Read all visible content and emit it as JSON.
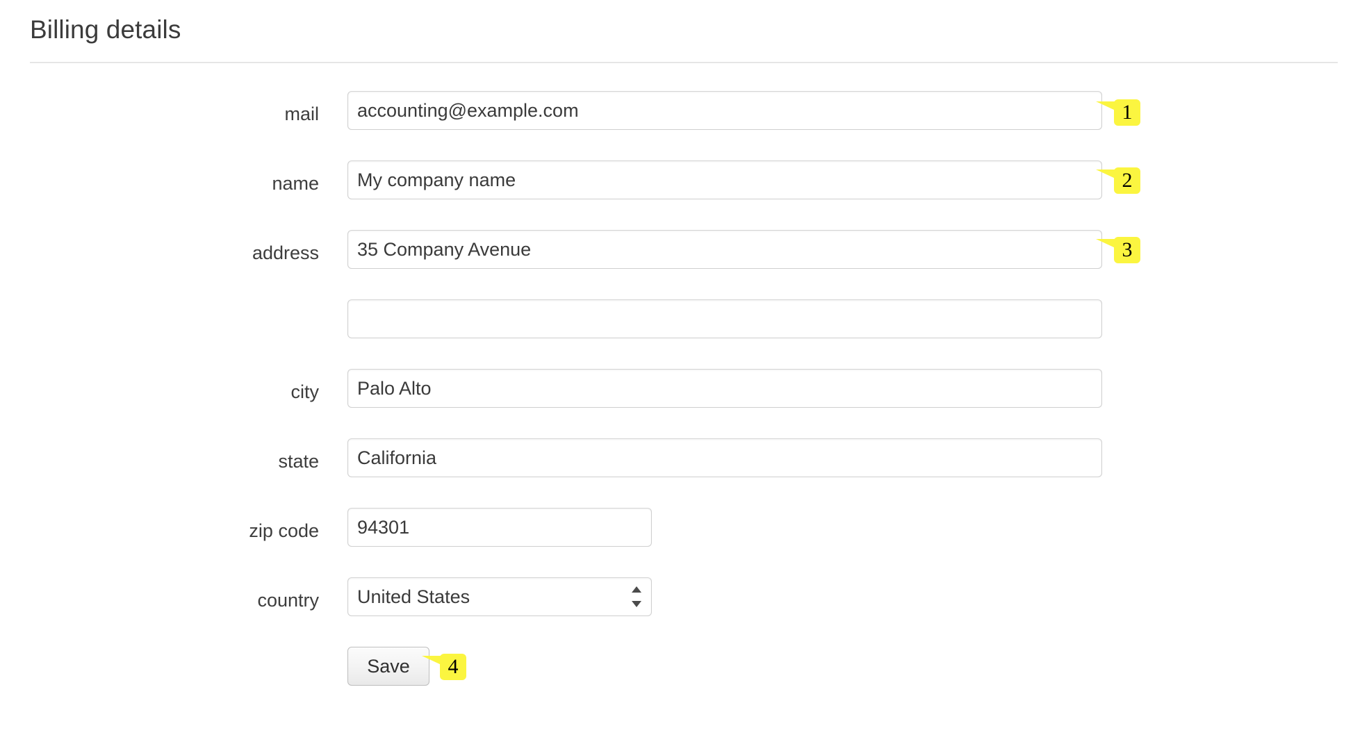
{
  "header": {
    "title": "Billing details"
  },
  "form": {
    "fields": [
      {
        "id": "mail",
        "label": "mail",
        "value": "accounting@example.com",
        "placeholder": "",
        "width": "wide",
        "type": "text",
        "badge": "1"
      },
      {
        "id": "name",
        "label": "name",
        "value": "My company name",
        "placeholder": "",
        "width": "wide",
        "type": "text",
        "badge": "2"
      },
      {
        "id": "address",
        "label": "address",
        "value": "35 Company Avenue",
        "placeholder": "",
        "width": "wide",
        "type": "text",
        "badge": "3"
      },
      {
        "id": "address2",
        "label": "",
        "value": "",
        "placeholder": "",
        "width": "wide",
        "type": "text",
        "badge": ""
      },
      {
        "id": "city",
        "label": "city",
        "value": "Palo Alto",
        "placeholder": "",
        "width": "wide",
        "type": "text",
        "badge": ""
      },
      {
        "id": "state",
        "label": "state",
        "value": "California",
        "placeholder": "",
        "width": "wide",
        "type": "text",
        "badge": ""
      },
      {
        "id": "zip",
        "label": "zip code",
        "value": "94301",
        "placeholder": "",
        "width": "narrow",
        "type": "text",
        "badge": ""
      },
      {
        "id": "country",
        "label": "country",
        "value": "United States",
        "placeholder": "",
        "width": "narrow",
        "type": "select",
        "badge": ""
      }
    ],
    "save": {
      "label": "Save",
      "badge": "4"
    }
  },
  "annotations": {
    "badge_color": "#FBF540",
    "badge_text_color": "#000000",
    "numbers": [
      "1",
      "2",
      "3",
      "4"
    ]
  },
  "colors": {
    "page_background": "#FFFFFF",
    "title_text": "#3B3B3B",
    "label_text": "#3D3D3D",
    "input_text": "#3A3A3A",
    "input_border": "#CFCFCF",
    "divider": "#E6E6E6",
    "button_border": "#BDBDBD"
  }
}
